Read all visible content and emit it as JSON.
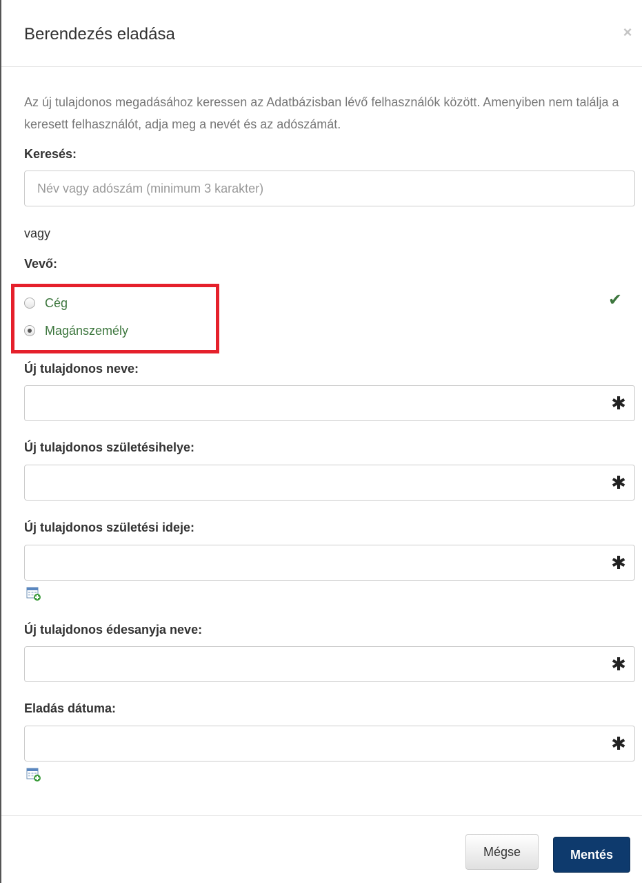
{
  "modal": {
    "title": "Berendezés eladása",
    "close_label": "×"
  },
  "intro": "Az új tulajdonos megadásához keressen az Adatbázisban lévő felhasználók között. Amenyiben nem találja a keresett felhasználót, adja meg a nevét és az adószámát.",
  "search": {
    "label": "Keresés:",
    "placeholder": "Név vagy adószám (minimum 3 karakter)",
    "value": ""
  },
  "or_text": "vagy",
  "buyer": {
    "label": "Vevő:",
    "options": [
      {
        "label": "Cég",
        "checked": false
      },
      {
        "label": "Magánszemély",
        "checked": true
      }
    ],
    "valid_mark": "✔"
  },
  "fields": {
    "owner_name": {
      "label": "Új tulajdonos neve:",
      "value": ""
    },
    "birth_place": {
      "label": "Új tulajdonos születésihelye:",
      "value": ""
    },
    "birth_date": {
      "label": "Új tulajdonos születési ideje:",
      "value": ""
    },
    "mother_name": {
      "label": "Új tulajdonos édesanyja neve:",
      "value": ""
    },
    "sale_date": {
      "label": "Eladás dátuma:",
      "value": ""
    }
  },
  "required_mark": "✱",
  "icons": {
    "required": "asterisk-icon",
    "calendar": "calendar-add-icon",
    "close": "close-icon",
    "valid": "checkmark-icon"
  },
  "colors": {
    "primary_button": "#0e3a6d",
    "success_text": "#3c763d",
    "highlight_box": "#e5202b"
  },
  "footer": {
    "cancel_label": "Mégse",
    "save_label": "Mentés"
  }
}
